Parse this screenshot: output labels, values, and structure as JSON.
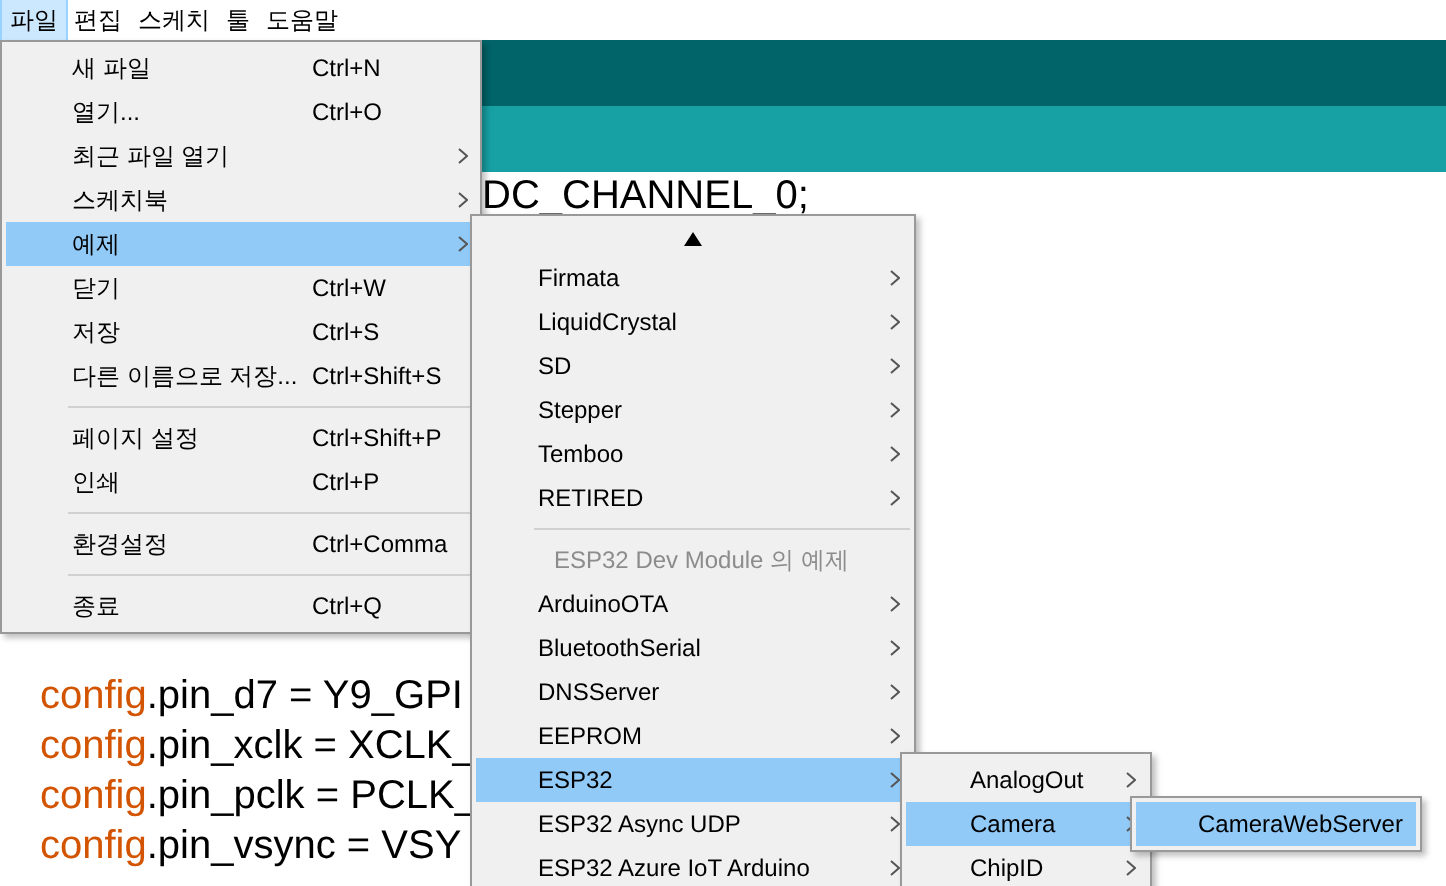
{
  "menubar": [
    {
      "label": "파일",
      "selected": true
    },
    {
      "label": "편집",
      "selected": false
    },
    {
      "label": "스케치",
      "selected": false
    },
    {
      "label": "툴",
      "selected": false
    },
    {
      "label": "도움말",
      "selected": false
    }
  ],
  "editor": {
    "top_line": {
      "text": "DC_CHANNEL_0;"
    },
    "lines": [
      {
        "object": "config",
        "rest": ".pin_d7 = Y9_GPI"
      },
      {
        "object": "config",
        "rest": ".pin_xclk = XCLK_"
      },
      {
        "object": "config",
        "rest": ".pin_pclk = PCLK_"
      },
      {
        "object": "config",
        "rest": ".pin_vsync = VSY"
      }
    ]
  },
  "file_menu": {
    "items": [
      {
        "kind": "item",
        "label": "새 파일",
        "shortcut": "Ctrl+N",
        "submenu": false,
        "selected": false
      },
      {
        "kind": "item",
        "label": "열기...",
        "shortcut": "Ctrl+O",
        "submenu": false,
        "selected": false
      },
      {
        "kind": "item",
        "label": "최근 파일 열기",
        "submenu": true,
        "selected": false
      },
      {
        "kind": "item",
        "label": "스케치북",
        "submenu": true,
        "selected": false
      },
      {
        "kind": "item",
        "label": "예제",
        "submenu": true,
        "selected": true
      },
      {
        "kind": "item",
        "label": "닫기",
        "shortcut": "Ctrl+W",
        "submenu": false,
        "selected": false
      },
      {
        "kind": "item",
        "label": "저장",
        "shortcut": "Ctrl+S",
        "submenu": false,
        "selected": false
      },
      {
        "kind": "item",
        "label": "다른 이름으로 저장...",
        "shortcut": "Ctrl+Shift+S",
        "submenu": false,
        "selected": false
      },
      {
        "kind": "separator"
      },
      {
        "kind": "item",
        "label": "페이지 설정",
        "shortcut": "Ctrl+Shift+P",
        "submenu": false,
        "selected": false
      },
      {
        "kind": "item",
        "label": "인쇄",
        "shortcut": "Ctrl+P",
        "submenu": false,
        "selected": false
      },
      {
        "kind": "separator"
      },
      {
        "kind": "item",
        "label": "환경설정",
        "shortcut": "Ctrl+Comma",
        "submenu": false,
        "selected": false
      },
      {
        "kind": "separator"
      },
      {
        "kind": "item",
        "label": "종료",
        "shortcut": "Ctrl+Q",
        "submenu": false,
        "selected": false
      }
    ]
  },
  "examples_menu": {
    "scroll_up": true,
    "items": [
      {
        "kind": "item",
        "label": "Firmata",
        "submenu": true,
        "selected": false
      },
      {
        "kind": "item",
        "label": "LiquidCrystal",
        "submenu": true,
        "selected": false
      },
      {
        "kind": "item",
        "label": "SD",
        "submenu": true,
        "selected": false
      },
      {
        "kind": "item",
        "label": "Stepper",
        "submenu": true,
        "selected": false
      },
      {
        "kind": "item",
        "label": "Temboo",
        "submenu": true,
        "selected": false
      },
      {
        "kind": "item",
        "label": "RETIRED",
        "submenu": true,
        "selected": false
      },
      {
        "kind": "separator"
      },
      {
        "kind": "header",
        "label": "ESP32 Dev Module 의 예제"
      },
      {
        "kind": "item",
        "label": "ArduinoOTA",
        "submenu": true,
        "selected": false
      },
      {
        "kind": "item",
        "label": "BluetoothSerial",
        "submenu": true,
        "selected": false
      },
      {
        "kind": "item",
        "label": "DNSServer",
        "submenu": true,
        "selected": false
      },
      {
        "kind": "item",
        "label": "EEPROM",
        "submenu": true,
        "selected": false
      },
      {
        "kind": "item",
        "label": "ESP32",
        "submenu": true,
        "selected": true
      },
      {
        "kind": "item",
        "label": "ESP32 Async UDP",
        "submenu": true,
        "selected": false
      },
      {
        "kind": "item",
        "label": "ESP32 Azure IoT Arduino",
        "submenu": true,
        "selected": false
      }
    ]
  },
  "esp32_menu": {
    "items": [
      {
        "kind": "item",
        "label": "AnalogOut",
        "submenu": true,
        "selected": false
      },
      {
        "kind": "item",
        "label": "Camera",
        "submenu": true,
        "selected": true
      },
      {
        "kind": "item",
        "label": "ChipID",
        "submenu": true,
        "selected": false
      }
    ]
  },
  "camera_menu": {
    "items": [
      {
        "kind": "item",
        "label": "CameraWebServer",
        "selected": true
      }
    ]
  }
}
